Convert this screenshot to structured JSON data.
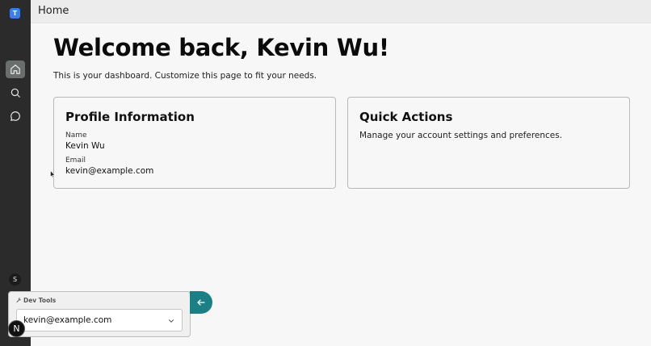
{
  "sidebar": {
    "logo_letter": "T",
    "user_initial": "S",
    "items": [
      {
        "icon": "home-icon",
        "active": true
      },
      {
        "icon": "search-icon",
        "active": false
      },
      {
        "icon": "chat-icon",
        "active": false
      }
    ]
  },
  "header": {
    "title": "Home"
  },
  "main": {
    "welcome": "Welcome back, Kevin Wu!",
    "subtitle": "This is your dashboard. Customize this page to fit your needs.",
    "profile_card": {
      "title": "Profile Information",
      "name_label": "Name",
      "name_value": "Kevin Wu",
      "email_label": "Email",
      "email_value": "kevin@example.com"
    },
    "quick_actions_card": {
      "title": "Quick Actions",
      "description": "Manage your account settings and preferences."
    }
  },
  "devtools": {
    "label": "Dev Tools",
    "selected_user": "kevin@example.com"
  },
  "nextjs_badge": "N",
  "colors": {
    "sidebar_bg": "#2b2b2b",
    "active_nav": "#6a6f6e",
    "logo_accent": "#3d7cf0",
    "back_button": "#1b7f86"
  }
}
